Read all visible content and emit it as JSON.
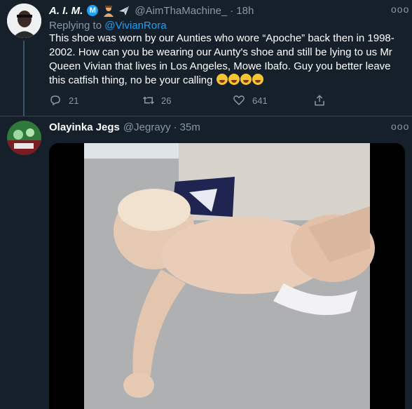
{
  "tweet1": {
    "display_name": "A. I. M.",
    "handle": "@AimThaMachine_",
    "separator": "·",
    "time": "18h",
    "badge_letter": "M",
    "header_icons": [
      "verified-m-badge-icon",
      "person-emoji-icon",
      "airplane-emoji-icon"
    ],
    "replying_label": "Replying to",
    "replying_handle": "@VivianRora",
    "text": "This shoe was worn by our Aunties who wore “Apoche” back then in 1998-2002. How can you be wearing our Aunty's shoe and still be lying to us Mr Queen Vivian that lives in Los Angeles, Mowe Ibafo. Guy you better leave this catfish thing, no be your calling",
    "trailing_emojis": [
      "tears-of-joy",
      "tears-of-joy",
      "tears-of-joy",
      "tears-of-joy"
    ],
    "reply_count": "21",
    "retweet_count": "26",
    "like_count": "641",
    "more_label": "ooo"
  },
  "tweet2": {
    "display_name": "Olayinka Jegs",
    "handle": "@Jegrayy",
    "separator": "·",
    "time": "35m",
    "more_label": "ooo",
    "media_type": "video"
  },
  "colors": {
    "background": "#15202b",
    "text": "#ffffff",
    "muted": "#8899a6",
    "link": "#1da1f2",
    "divider": "#38444d"
  }
}
